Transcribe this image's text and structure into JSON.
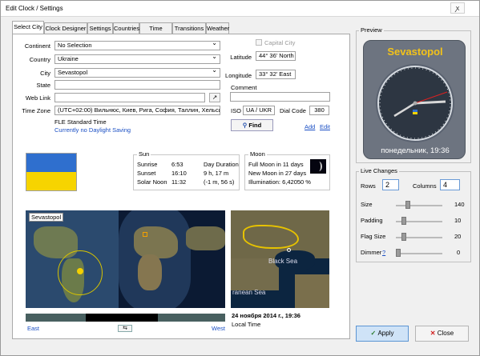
{
  "window": {
    "title": "Edit Clock / Settings",
    "close": "ꭗ"
  },
  "tabs": [
    "Select City",
    "Clock Designer",
    "Settings",
    "Countries",
    "Time Zones",
    "Transitions",
    "Weather"
  ],
  "form": {
    "continent_label": "Continent",
    "continent": "No Selection",
    "country_label": "Country",
    "country": "Ukraine",
    "city_label": "City",
    "city": "Sevastopol",
    "state_label": "State",
    "state": "",
    "weblink_label": "Web Link",
    "weblink": "",
    "timezone_label": "Time Zone",
    "timezone": "(UTC+02:00) Вильнюс, Киев, Рига, София, Таллин, Хельсинки",
    "tz_std": "FLE Standard Time",
    "tz_dst": "Currently no Daylight Saving",
    "capital_label": "Capital City",
    "latitude_label": "Latitude",
    "latitude": "44° 36' North",
    "longitude_label": "Longitude",
    "longitude": "33° 32' East",
    "comment_label": "Comment",
    "comment": "",
    "iso_label": "ISO",
    "iso": "UA / UKR",
    "dial_label": "Dial Code",
    "dial": "380",
    "find": "Find",
    "add": "Add",
    "edit": "Edit"
  },
  "sun": {
    "title": "Sun",
    "sunrise_label": "Sunrise",
    "sunrise": "6:53",
    "sunset_label": "Sunset",
    "sunset": "16:10",
    "noon_label": "Solar Noon",
    "noon": "11:32",
    "dur_label": "Day Duration",
    "dur": "9 h, 17 m",
    "diff": "(-1 m, 56 s)"
  },
  "moon": {
    "title": "Moon",
    "full": "Full Moon in 11 days",
    "new": "New Moon in 27 days",
    "illum": "Illumination: 6,42050 %"
  },
  "map": {
    "city_tag": "Sevastopol",
    "east": "East",
    "west": "West",
    "sea": "Black Sea",
    "sea2": "ranean Sea",
    "date": "24 ноября 2014 г., 19:36",
    "local": "Local Time"
  },
  "preview": {
    "title": "Preview",
    "city": "Sevastopol",
    "day": "понедельник, 19:36"
  },
  "live": {
    "title": "Live Changes",
    "rows_label": "Rows",
    "rows": "2",
    "cols_label": "Columns",
    "cols": "4",
    "size_label": "Size",
    "size": "140",
    "pad_label": "Padding",
    "pad": "10",
    "flag_label": "Flag Size",
    "flag": "20",
    "dim_label": "Dimmer",
    "dim_q": "?",
    "dim": "0"
  },
  "buttons": {
    "apply": "Apply",
    "close": "Close"
  },
  "colors": {
    "flag_blue": "#2f6fce",
    "flag_yellow": "#f6d400",
    "link": "#1a4fc4"
  }
}
